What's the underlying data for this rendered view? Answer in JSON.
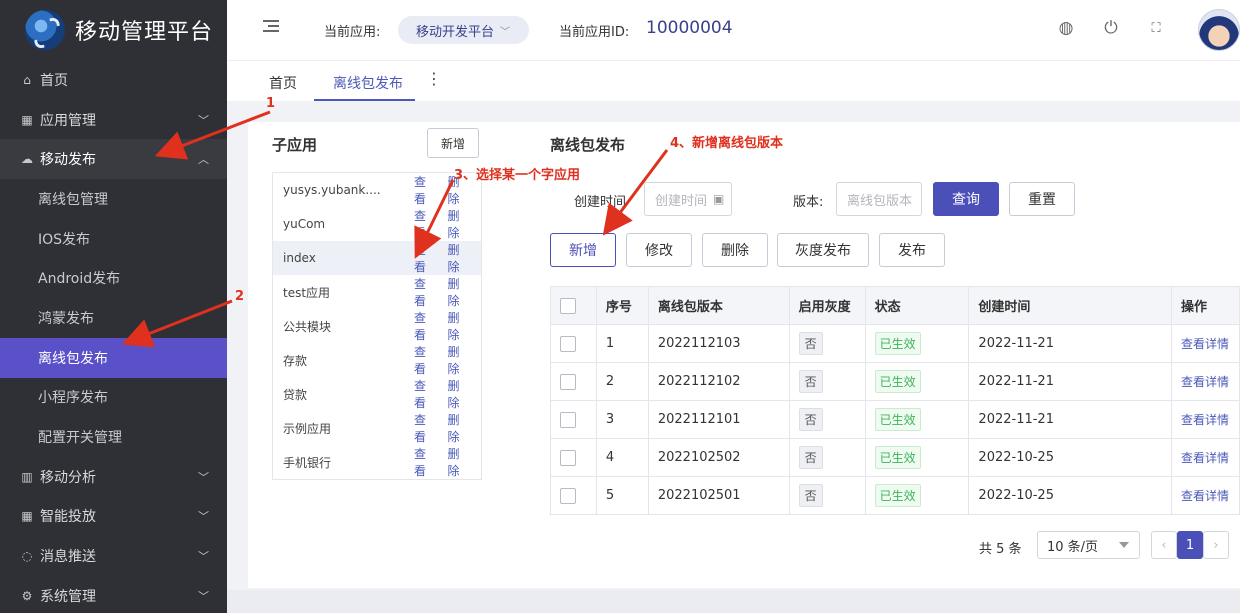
{
  "brand": {
    "title": "移动管理平台"
  },
  "sidebar": {
    "items": [
      {
        "label": "首页",
        "icon": "home-icon",
        "glyph": "⌂"
      },
      {
        "label": "应用管理",
        "icon": "grid-icon",
        "glyph": "▦"
      },
      {
        "label": "移动发布",
        "icon": "cloud-upload-icon",
        "glyph": "☁"
      },
      {
        "label": "离线包管理"
      },
      {
        "label": "IOS发布"
      },
      {
        "label": "Android发布"
      },
      {
        "label": "鸿蒙发布"
      },
      {
        "label": "离线包发布"
      },
      {
        "label": "小程序发布"
      },
      {
        "label": "配置开关管理"
      },
      {
        "label": "移动分析",
        "icon": "bar-chart-icon",
        "glyph": "▥"
      },
      {
        "label": "智能投放",
        "icon": "grid-icon",
        "glyph": "▦"
      },
      {
        "label": "消息推送",
        "icon": "chat-icon",
        "glyph": "◌"
      },
      {
        "label": "系统管理",
        "icon": "gear-icon",
        "glyph": "⚙"
      }
    ]
  },
  "header": {
    "current_app_label": "当前应用:",
    "current_app_value": "移动开发平台",
    "current_app_id_label": "当前应用ID:",
    "current_app_id": "10000004",
    "icons": [
      "globe-icon",
      "power-icon",
      "fullscreen-icon"
    ]
  },
  "tabs": [
    {
      "label": "首页"
    },
    {
      "label": "离线包发布"
    }
  ],
  "subapps": {
    "title": "子应用",
    "add_button": "新增",
    "view_label": "查看",
    "delete_label": "删除",
    "items": [
      "yusys.yubank....",
      "yuCom",
      "index",
      "test应用",
      "公共模块",
      "存款",
      "贷款",
      "示例应用",
      "手机银行"
    ]
  },
  "release": {
    "title": "离线包发布",
    "created_time_label": "创建时间",
    "created_time_placeholder": "创建时间",
    "version_label": "版本:",
    "version_placeholder": "离线包版本",
    "query_button": "查询",
    "reset_button": "重置",
    "actions": [
      "新增",
      "修改",
      "删除",
      "灰度发布",
      "发布"
    ]
  },
  "table": {
    "headers": [
      "序号",
      "离线包版本",
      "启用灰度",
      "状态",
      "创建时间",
      "操作"
    ],
    "rows": [
      {
        "no": "1",
        "version": "2022112103",
        "gray": "否",
        "status": "已生效",
        "created": "2022-11-21",
        "op": "查看详情"
      },
      {
        "no": "2",
        "version": "2022112102",
        "gray": "否",
        "status": "已生效",
        "created": "2022-11-21",
        "op": "查看详情"
      },
      {
        "no": "3",
        "version": "2022112101",
        "gray": "否",
        "status": "已生效",
        "created": "2022-11-21",
        "op": "查看详情"
      },
      {
        "no": "4",
        "version": "2022102502",
        "gray": "否",
        "status": "已生效",
        "created": "2022-10-25",
        "op": "查看详情"
      },
      {
        "no": "5",
        "version": "2022102501",
        "gray": "否",
        "status": "已生效",
        "created": "2022-10-25",
        "op": "查看详情"
      }
    ]
  },
  "pager": {
    "total": "共 5 条",
    "page_size": "10 条/页",
    "current_page": "1"
  },
  "annotations": {
    "a1": "1",
    "a2": "2",
    "a3": "3、选择某一个字应用",
    "a4": "4、新增离线包版本",
    "color": "#e0301e"
  }
}
